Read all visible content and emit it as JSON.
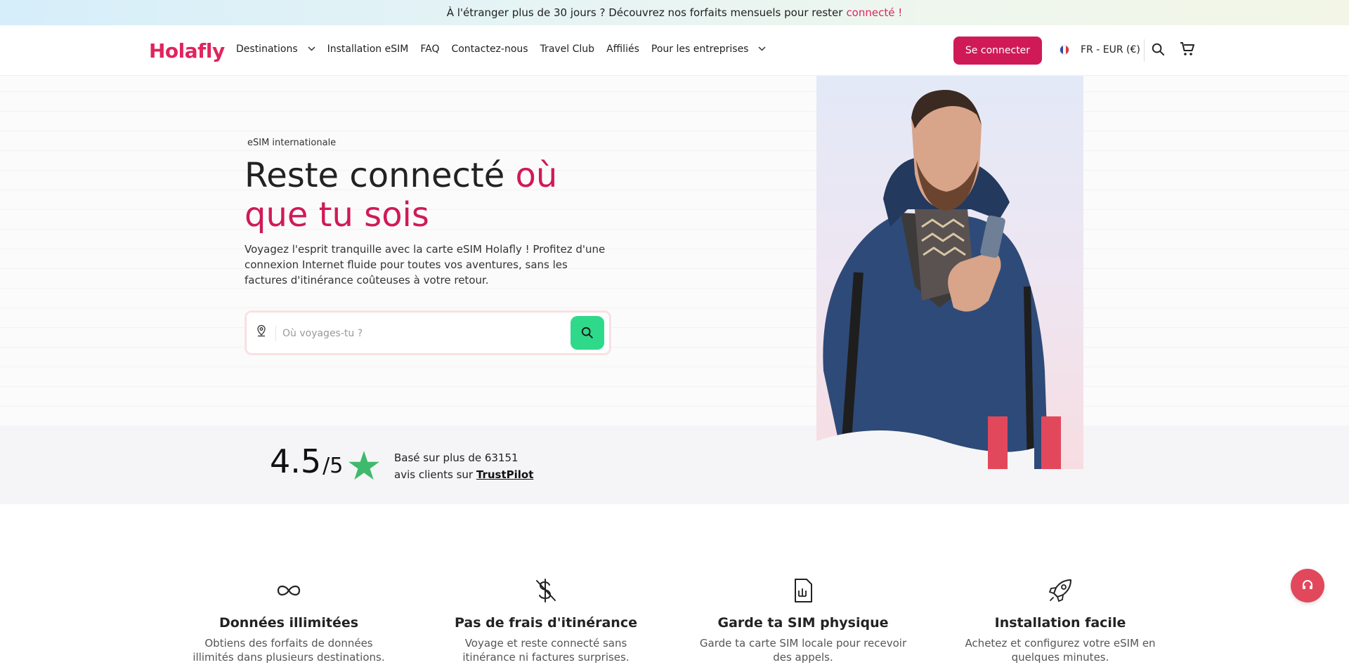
{
  "banner": {
    "text": "À l'étranger plus de 30 jours ? Découvrez nos forfaits mensuels pour rester",
    "highlight": "connecté !"
  },
  "nav": {
    "logo": "Holafly",
    "items": [
      {
        "label": "Destinations",
        "has_chevron": true
      },
      {
        "label": "Installation eSIM"
      },
      {
        "label": "FAQ"
      },
      {
        "label": "Contactez-nous"
      },
      {
        "label": "Travel Club"
      },
      {
        "label": "Affiliés"
      },
      {
        "label": "Pour les entreprises",
        "has_chevron": true
      }
    ],
    "login": "Se connecter",
    "locale": "FR - EUR (€)"
  },
  "hero": {
    "eyebrow": "eSIM internationale",
    "title_part1": "Reste connecté",
    "title_part2": "où",
    "title_part3": "que tu sois",
    "lead": "Voyagez l'esprit tranquille avec la carte eSIM Holafly ! Profitez d'une connexion Internet fluide pour toutes vos aventures, sans les factures d'itinérance coûteuses à votre retour.",
    "search_placeholder": "Où voyages-tu ?"
  },
  "rating": {
    "score": "4.5",
    "out_of": "/5",
    "line1": "Basé sur plus de 63151",
    "line2": "avis clients sur",
    "link": "TrustPilot"
  },
  "features": [
    {
      "icon": "infinity-icon",
      "title": "Données illimitées",
      "desc": "Obtiens des forfaits de données illimités dans plusieurs destinations."
    },
    {
      "icon": "no-dollar-icon",
      "title": "Pas de frais d'itinérance",
      "desc": "Voyage et reste connecté sans itinérance ni factures surprises."
    },
    {
      "icon": "sim-card-icon",
      "title": "Garde ta SIM physique",
      "desc": "Garde ta carte SIM locale pour recevoir des appels."
    },
    {
      "icon": "rocket-icon",
      "title": "Installation facile",
      "desc": "Achetez et configurez votre eSIM en quelques minutes."
    }
  ],
  "colors": {
    "brand": "#d01a57",
    "accent_green": "#2fd98a",
    "trustpilot_star": "#3fba6c"
  }
}
